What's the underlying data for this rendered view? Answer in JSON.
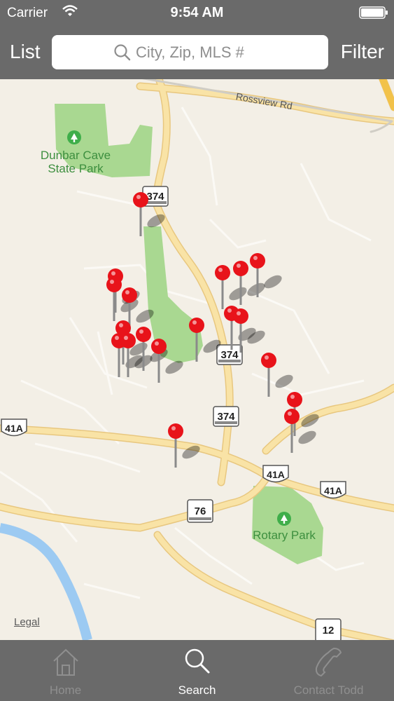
{
  "status": {
    "carrier": "Carrier",
    "time": "9:54 AM"
  },
  "nav": {
    "list_label": "List",
    "filter_label": "Filter"
  },
  "search": {
    "placeholder": "City, Zip, MLS #"
  },
  "map": {
    "labels": {
      "park1_line1": "Dunbar Cave",
      "park1_line2": "State Park",
      "road1": "Rossview Rd",
      "park2": "Rotary Park",
      "legal": "Legal"
    },
    "shields": {
      "r374a": "374",
      "r374b": "374",
      "r374c": "374",
      "r41a_left": "41A",
      "r41a_mid": "41A",
      "r41a_right": "41A",
      "r76": "76",
      "r12": "12"
    },
    "pin_color": "#e8131a",
    "park_color": "#a9d891",
    "road_color": "#f7df9c",
    "water_color": "#9ccaf2"
  },
  "tabs": [
    {
      "label": "Home",
      "state": "disabled"
    },
    {
      "label": "Search",
      "state": "active"
    },
    {
      "label": "Contact Todd",
      "state": "disabled"
    }
  ]
}
